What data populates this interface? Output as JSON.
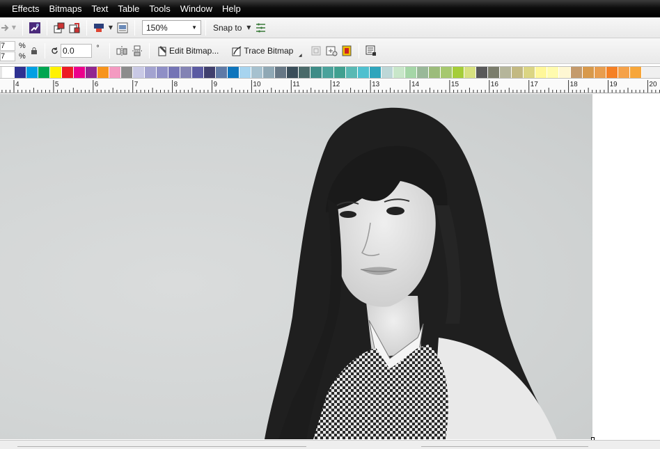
{
  "menu": {
    "items": [
      "Effects",
      "Bitmaps",
      "Text",
      "Table",
      "Tools",
      "Window",
      "Help"
    ]
  },
  "toolbar1": {
    "zoom_value": "150%",
    "snap_label": "Snap to"
  },
  "toolbar2": {
    "scale_x": "7",
    "scale_y": "7",
    "percent_symbol": "%",
    "rotation_value": "0.0",
    "degree_symbol": "°",
    "edit_bitmap_label": "Edit Bitmap...",
    "trace_bitmap_label": "Trace Bitmap"
  },
  "palette": {
    "colors": [
      "#e6e6e6",
      "#ffffff",
      "#2e3192",
      "#00a0e3",
      "#00a651",
      "#fff200",
      "#ed1c24",
      "#ec008c",
      "#92278f",
      "#f7941d",
      "#f49ac1",
      "#8c8c8c",
      "#c9c9e5",
      "#a3a3d0",
      "#8f8fc6",
      "#7474b5",
      "#8383b4",
      "#5b5ba2",
      "#40406e",
      "#5f7aa6",
      "#0f75bc",
      "#a7d4ef",
      "#a6c1cf",
      "#8fa8b5",
      "#667785",
      "#3a4e5a",
      "#4a6a6a",
      "#3e8c87",
      "#4aa29b",
      "#40a090",
      "#58b9b4",
      "#4fc0cf",
      "#30a5bc",
      "#bdd7d7",
      "#c8e6c9",
      "#a5d6a7",
      "#99b898",
      "#9cbc7b",
      "#a6c86e",
      "#a5cd39",
      "#d7e180",
      "#595959",
      "#7b7d6c",
      "#b5b59a",
      "#c3b982",
      "#dbd583",
      "#fff799",
      "#fffbae",
      "#fef7d3",
      "#c49a6c",
      "#d8994b",
      "#e89d4e",
      "#f58024",
      "#f5a24a",
      "#f7a63a"
    ]
  },
  "ruler": {
    "labels": [
      "4",
      "5",
      "6",
      "7",
      "8",
      "9",
      "10",
      "11",
      "12",
      "13",
      "14",
      "15",
      "16",
      "17",
      "18",
      "19",
      "20"
    ]
  }
}
